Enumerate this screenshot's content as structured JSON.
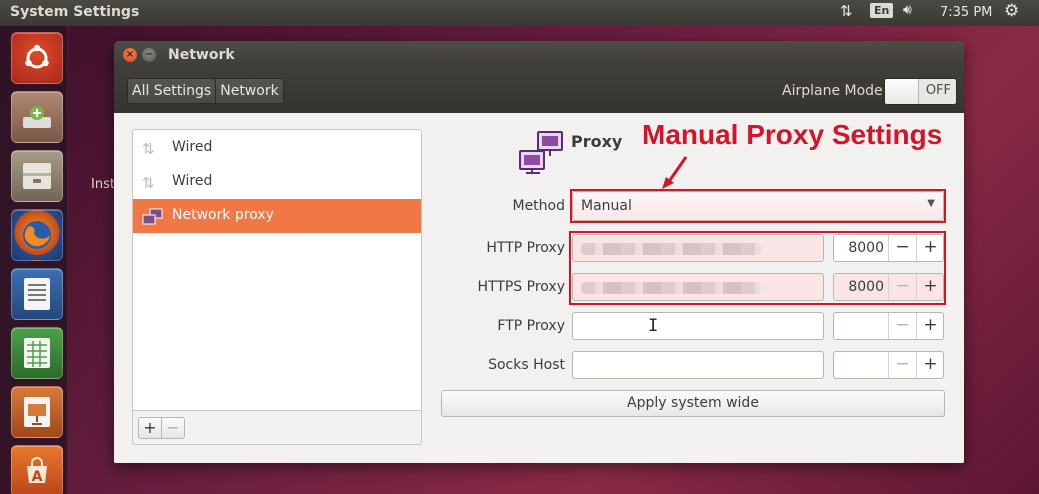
{
  "top_panel": {
    "app_title": "System Settings",
    "keyboard_lang": "En",
    "clock": "7:35 PM",
    "icons": [
      "network-transfer-icon",
      "volume-icon",
      "gear-icon"
    ]
  },
  "launcher": {
    "items": [
      "ubuntu-dash",
      "software-updater",
      "files",
      "firefox",
      "libreoffice-writer",
      "libreoffice-calc",
      "libreoffice-impress",
      "ubuntu-software-center"
    ]
  },
  "background_text": "Inst",
  "window": {
    "title": "Network",
    "breadcrumbs": [
      "All Settings",
      "Network"
    ],
    "airplane_mode": {
      "label": "Airplane Mode",
      "state": "OFF"
    }
  },
  "devices": [
    {
      "label": "Wired",
      "icon": "wired-network-icon",
      "selected": false
    },
    {
      "label": "Wired",
      "icon": "wired-network-icon",
      "selected": false
    },
    {
      "label": "Network proxy",
      "icon": "network-proxy-icon",
      "selected": true
    }
  ],
  "list_footer": {
    "add": "+",
    "remove": "−"
  },
  "proxy": {
    "heading": "Proxy",
    "method": {
      "label": "Method",
      "value": "Manual"
    },
    "http": {
      "label": "HTTP Proxy",
      "host": "",
      "port": "8000"
    },
    "https": {
      "label": "HTTPS Proxy",
      "host": "",
      "port": "8000"
    },
    "ftp": {
      "label": "FTP Proxy",
      "host": "",
      "port": ""
    },
    "socks": {
      "label": "Socks Host",
      "host": "",
      "port": ""
    },
    "apply_label": "Apply system wide"
  },
  "annotation": {
    "text": "Manual Proxy Settings",
    "color": "#d3152a"
  },
  "colors": {
    "accent": "#f07746",
    "highlight": "#d3152a"
  }
}
